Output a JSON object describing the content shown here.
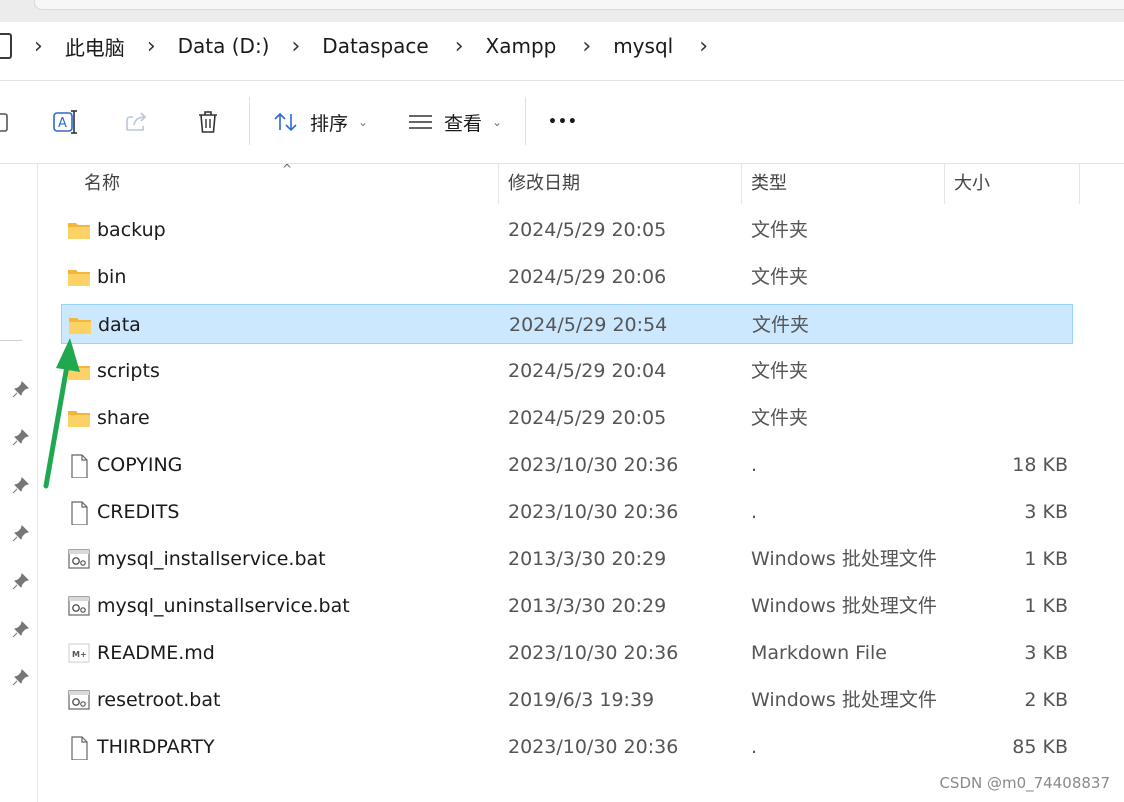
{
  "breadcrumb": [
    "此电脑",
    "Data (D:)",
    "Dataspace",
    "Xampp",
    "mysql"
  ],
  "toolbar": {
    "icons": [
      "paste-icon",
      "rename-icon",
      "share-icon",
      "delete-icon"
    ],
    "sort_label": "排序",
    "view_label": "查看",
    "more_label": "•••"
  },
  "columns": {
    "name": "名称",
    "date": "修改日期",
    "type": "类型",
    "size": "大小"
  },
  "files": [
    {
      "name": "backup",
      "date": "2024/5/29 20:05",
      "type": "文件夹",
      "size": "",
      "icon": "folder-icon"
    },
    {
      "name": "bin",
      "date": "2024/5/29 20:06",
      "type": "文件夹",
      "size": "",
      "icon": "folder-icon"
    },
    {
      "name": "data",
      "date": "2024/5/29 20:54",
      "type": "文件夹",
      "size": "",
      "icon": "folder-icon",
      "selected": true
    },
    {
      "name": "scripts",
      "date": "2024/5/29 20:04",
      "type": "文件夹",
      "size": "",
      "icon": "folder-icon"
    },
    {
      "name": "share",
      "date": "2024/5/29 20:05",
      "type": "文件夹",
      "size": "",
      "icon": "folder-icon"
    },
    {
      "name": "COPYING",
      "date": "2023/10/30 20:36",
      "type": ".",
      "size": "18 KB",
      "icon": "file-icon"
    },
    {
      "name": "CREDITS",
      "date": "2023/10/30 20:36",
      "type": ".",
      "size": "3 KB",
      "icon": "file-icon"
    },
    {
      "name": "mysql_installservice.bat",
      "date": "2013/3/30 20:29",
      "type": "Windows 批处理文件",
      "size": "1 KB",
      "icon": "batch-file-icon"
    },
    {
      "name": "mysql_uninstallservice.bat",
      "date": "2013/3/30 20:29",
      "type": "Windows 批处理文件",
      "size": "1 KB",
      "icon": "batch-file-icon"
    },
    {
      "name": "README.md",
      "date": "2023/10/30 20:36",
      "type": "Markdown File",
      "size": "3 KB",
      "icon": "markdown-file-icon"
    },
    {
      "name": "resetroot.bat",
      "date": "2019/6/3 19:39",
      "type": "Windows 批处理文件",
      "size": "2 KB",
      "icon": "batch-file-icon"
    },
    {
      "name": "THIRDPARTY",
      "date": "2023/10/30 20:36",
      "type": ".",
      "size": "85 KB",
      "icon": "file-icon"
    }
  ],
  "watermark": "CSDN @m0_74408837",
  "colors": {
    "selection": "#cce8ff",
    "selection_border": "#99d1ff",
    "folder": "#f8c94a",
    "annotation_arrow": "#1fa84f"
  }
}
